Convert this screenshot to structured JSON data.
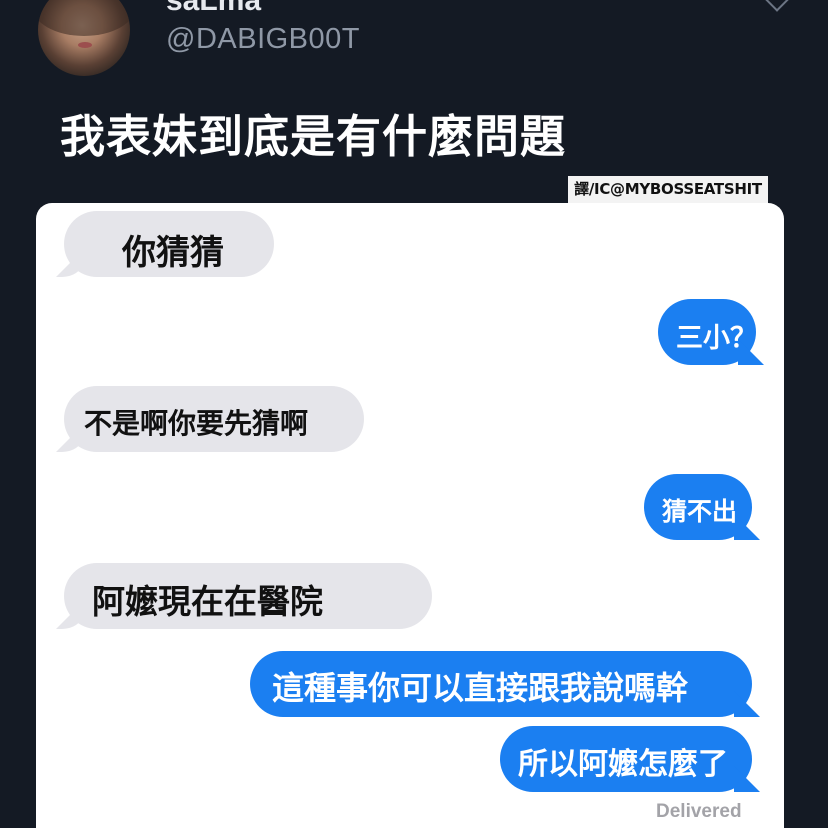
{
  "tweet": {
    "display_name": "saLma",
    "handle": "@DABIGB00T",
    "text": "我表妹到底是有什麼問題"
  },
  "translation_credit": "譯/IC@MYBOSSEATSHIT",
  "messages": [
    {
      "direction": "received",
      "text": "你猜猜"
    },
    {
      "direction": "sent",
      "text": "三小？"
    },
    {
      "direction": "received",
      "text": "不是啊你要先猜啊"
    },
    {
      "direction": "sent",
      "text": "猜不出"
    },
    {
      "direction": "received",
      "text": "阿嬤現在在醫院"
    },
    {
      "direction": "sent",
      "text": "這種事你可以直接跟我說嗎幹"
    },
    {
      "direction": "sent",
      "text": "所以阿嬤怎麼了"
    }
  ],
  "status": "Delivered",
  "colors": {
    "background": "#141a24",
    "sent_bubble": "#1b7ff1",
    "received_bubble": "#e5e5ea"
  }
}
